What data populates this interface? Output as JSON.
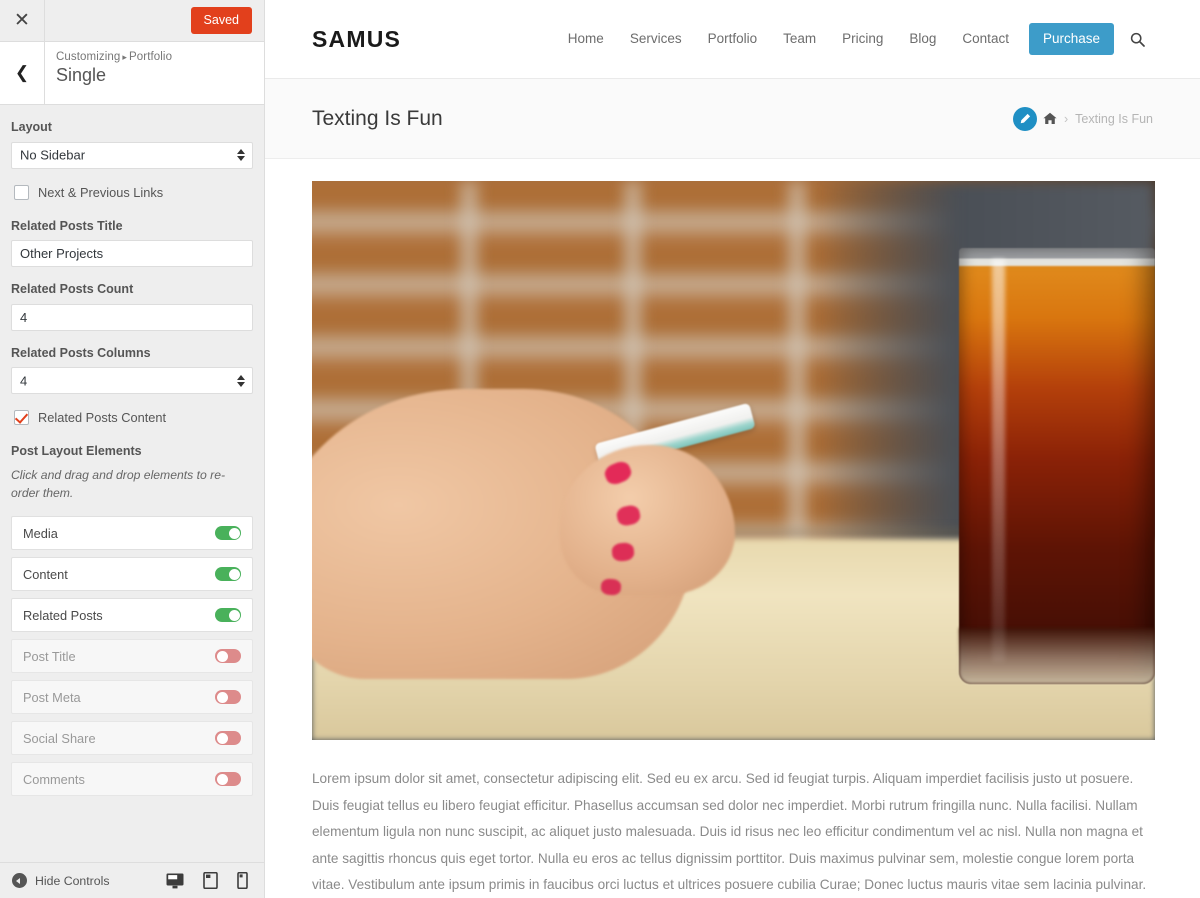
{
  "customizer": {
    "close_icon": "close-icon",
    "saved_button": "Saved",
    "back_icon": "chevron-left-icon",
    "breadcrumb_root": "Customizing",
    "breadcrumb_sep": "▸",
    "breadcrumb_section": "Portfolio",
    "panel_title": "Single",
    "controls": {
      "layout_label": "Layout",
      "layout_value": "No Sidebar",
      "next_prev_label": "Next & Previous Links",
      "next_prev_checked": false,
      "related_title_label": "Related Posts Title",
      "related_title_value": "Other Projects",
      "related_count_label": "Related Posts Count",
      "related_count_value": "4",
      "related_columns_label": "Related Posts Columns",
      "related_columns_value": "4",
      "related_content_label": "Related Posts Content",
      "related_content_checked": true,
      "post_layout_label": "Post Layout Elements",
      "post_layout_desc": "Click and drag and drop elements to re-order them."
    },
    "layout_elements": [
      {
        "label": "Media",
        "enabled": true
      },
      {
        "label": "Content",
        "enabled": true
      },
      {
        "label": "Related Posts",
        "enabled": true
      },
      {
        "label": "Post Title",
        "enabled": false
      },
      {
        "label": "Post Meta",
        "enabled": false
      },
      {
        "label": "Social Share",
        "enabled": false
      },
      {
        "label": "Comments",
        "enabled": false
      }
    ],
    "footer": {
      "hide_controls_label": "Hide Controls",
      "devices": [
        "desktop-icon",
        "tablet-icon",
        "mobile-icon"
      ]
    },
    "colors": {
      "saved_red": "#e2401c",
      "toggle_on_green": "#49b15b",
      "toggle_off_red": "#dd8b8b",
      "checkbox_check": "#e2401c"
    }
  },
  "preview": {
    "brand": "SAMUS",
    "nav": [
      {
        "label": "Home"
      },
      {
        "label": "Services"
      },
      {
        "label": "Portfolio"
      },
      {
        "label": "Team"
      },
      {
        "label": "Pricing"
      },
      {
        "label": "Blog"
      },
      {
        "label": "Contact"
      }
    ],
    "purchase_label": "Purchase",
    "search_icon": "search-icon",
    "page_title": "Texting Is Fun",
    "breadcrumb": {
      "edit_icon": "edit-pencil-icon",
      "home_icon": "home-icon",
      "separator": "›",
      "current": "Texting Is Fun"
    },
    "featured_image_alt": "Woman texting on a white smartphone at a wooden table next to a glass of iced cola, blurred brick wall background",
    "body_text": "Lorem ipsum dolor sit amet, consectetur adipiscing elit. Sed eu ex arcu. Sed id feugiat turpis. Aliquam imperdiet facilisis justo ut posuere. Duis feugiat tellus eu libero feugiat efficitur. Phasellus accumsan sed dolor nec imperdiet. Morbi rutrum fringilla nunc. Nulla facilisi. Nullam elementum ligula non nunc suscipit, ac aliquet justo malesuada. Duis id risus nec leo efficitur condimentum vel ac nisl. Nulla non magna et ante sagittis rhoncus quis eget tortor. Nulla eu eros ac tellus dignissim porttitor. Duis maximus pulvinar sem, molestie congue lorem porta vitae. Vestibulum ante ipsum primis in faucibus orci luctus et ultrices posuere cubilia Curae; Donec luctus mauris vitae sem lacinia pulvinar.",
    "colors": {
      "purchase_blue": "#3d9cc9",
      "edit_blue": "#1f8fc4"
    }
  }
}
